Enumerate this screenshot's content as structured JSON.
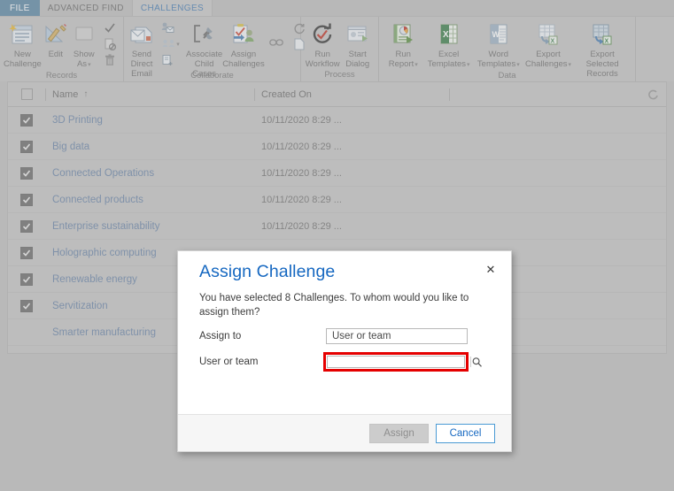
{
  "tabs": [
    {
      "label": "FILE",
      "kind": "file"
    },
    {
      "label": "ADVANCED FIND",
      "kind": "normal"
    },
    {
      "label": "CHALLENGES",
      "kind": "active"
    }
  ],
  "ribbon": {
    "groups": [
      {
        "label": "Records",
        "big": [
          {
            "label": "New\nChallenge",
            "icon": "new-record-icon"
          },
          {
            "label": "Edit",
            "icon": "edit-pencil-ruler-icon"
          },
          {
            "label": "Show\nAs",
            "icon": "show-as-icon",
            "caret": true
          }
        ],
        "small": [
          {
            "icon": "activate-check-icon"
          },
          {
            "icon": "deactivate-icon"
          },
          {
            "icon": "delete-trash-icon"
          }
        ]
      },
      {
        "label": "Collaborate",
        "big": [
          {
            "label": "Send Direct\nEmail",
            "icon": "send-direct-email-icon"
          },
          {
            "label": "Associate Child\nCases",
            "icon": "associate-child-cases-icon"
          },
          {
            "label": "Assign\nChallenges",
            "icon": "assign-challenges-icon"
          }
        ],
        "small": [
          {
            "icon": "add-contact-email-icon"
          },
          {
            "icon": "connect-people-icon",
            "caret": true
          },
          {
            "icon": "add-to-queue-icon"
          },
          {
            "icon": "link-chain-icon"
          },
          {
            "icon": "sync-circle-icon"
          },
          {
            "icon": "blank-page-icon"
          }
        ]
      },
      {
        "label": "Process",
        "big": [
          {
            "label": "Run\nWorkflow",
            "icon": "run-workflow-icon"
          },
          {
            "label": "Start\nDialog",
            "icon": "start-dialog-icon"
          }
        ],
        "small": []
      },
      {
        "label": "Data",
        "big": [
          {
            "label": "Run\nReport",
            "icon": "run-report-icon",
            "caret": true
          },
          {
            "label": "Excel\nTemplates",
            "icon": "excel-templates-icon",
            "caret": true
          },
          {
            "label": "Word\nTemplates",
            "icon": "word-templates-icon",
            "caret": true
          },
          {
            "label": "Export\nChallenges",
            "icon": "export-challenges-icon",
            "caret": true
          },
          {
            "label": "Export Selected\nRecords",
            "icon": "export-selected-records-icon"
          }
        ],
        "small": []
      }
    ]
  },
  "grid": {
    "columns": [
      {
        "key": "name",
        "label": "Name",
        "sorted": true,
        "sort_arrow": "↑"
      },
      {
        "key": "created_on",
        "label": "Created On",
        "sorted": false,
        "sort_arrow": ""
      }
    ],
    "header_checkbox_checked": false,
    "refresh_icon": "refresh-icon",
    "rows": [
      {
        "checked": true,
        "name": "3D Printing",
        "created_on": "10/11/2020 8:29 ..."
      },
      {
        "checked": true,
        "name": "Big data",
        "created_on": "10/11/2020 8:29 ..."
      },
      {
        "checked": true,
        "name": "Connected Operations",
        "created_on": "10/11/2020 8:29 ..."
      },
      {
        "checked": true,
        "name": "Connected products",
        "created_on": "10/11/2020 8:29 ..."
      },
      {
        "checked": true,
        "name": "Enterprise sustainability",
        "created_on": "10/11/2020 8:29 ..."
      },
      {
        "checked": true,
        "name": "Holographic computing",
        "created_on": ""
      },
      {
        "checked": true,
        "name": "Renewable energy",
        "created_on": ""
      },
      {
        "checked": true,
        "name": "Servitization",
        "created_on": ""
      },
      {
        "checked": false,
        "name": "Smarter manufacturing",
        "created_on": ""
      }
    ]
  },
  "dialog": {
    "title": "Assign Challenge",
    "close_label": "✕",
    "message": "You have selected 8 Challenges. To whom would you like to assign them?",
    "fields": {
      "assign_to": {
        "label": "Assign to",
        "value": "User or team"
      },
      "user_or_team": {
        "label": "User or team",
        "value": "",
        "placeholder": "",
        "search_icon": "lookup-search-icon"
      }
    },
    "buttons": {
      "assign": {
        "label": "Assign",
        "disabled": true
      },
      "cancel": {
        "label": "Cancel",
        "disabled": false
      }
    },
    "highlight_color": "#e50000"
  }
}
